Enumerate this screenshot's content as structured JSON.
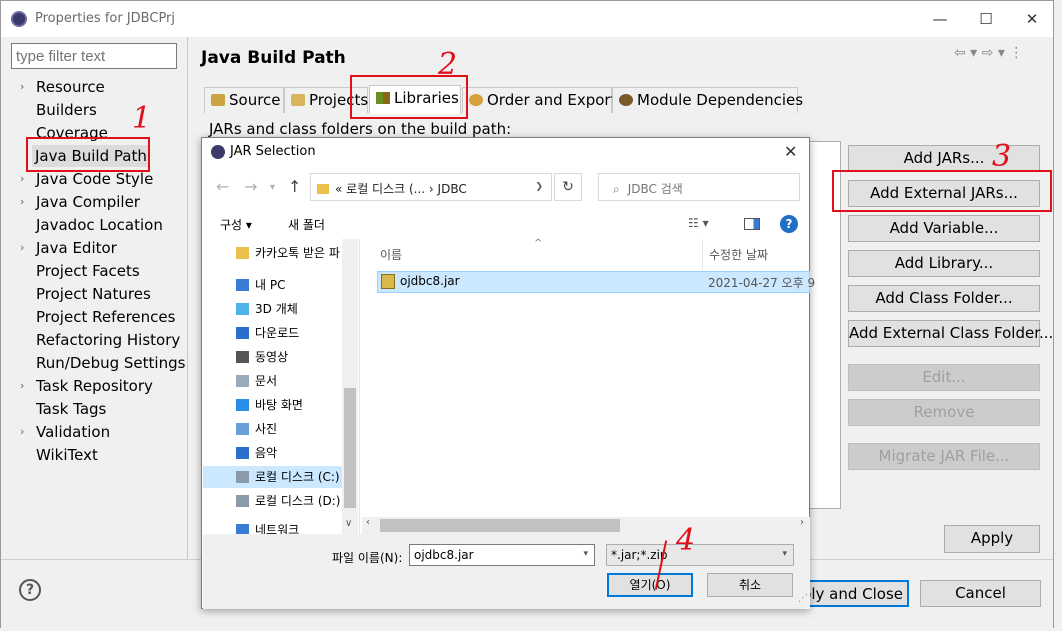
{
  "window": {
    "title": "Properties for JDBCPrj",
    "minimize_label": "—",
    "maximize_label": "☐",
    "close_label": "✕"
  },
  "filter": {
    "placeholder": "type filter text"
  },
  "tree": {
    "items": [
      {
        "label": "Resource",
        "expandable": true
      },
      {
        "label": "Builders",
        "expandable": false
      },
      {
        "label": "Coverage",
        "expandable": false
      },
      {
        "label": "Java Build Path",
        "expandable": false,
        "selected": true
      },
      {
        "label": "Java Code Style",
        "expandable": true
      },
      {
        "label": "Java Compiler",
        "expandable": true
      },
      {
        "label": "Javadoc Location",
        "expandable": false
      },
      {
        "label": "Java Editor",
        "expandable": true
      },
      {
        "label": "Project Facets",
        "expandable": false
      },
      {
        "label": "Project Natures",
        "expandable": false
      },
      {
        "label": "Project References",
        "expandable": false
      },
      {
        "label": "Refactoring History",
        "expandable": false
      },
      {
        "label": "Run/Debug Settings",
        "expandable": false
      },
      {
        "label": "Task Repository",
        "expandable": true
      },
      {
        "label": "Task Tags",
        "expandable": false
      },
      {
        "label": "Validation",
        "expandable": true
      },
      {
        "label": "WikiText",
        "expandable": false
      }
    ]
  },
  "page": {
    "title": "Java Build Path",
    "tabs": [
      {
        "label": "Source"
      },
      {
        "label": "Projects"
      },
      {
        "label": "Libraries",
        "active": true
      },
      {
        "label": "Order and Export"
      },
      {
        "label": "Module Dependencies"
      }
    ],
    "libraries_description": "JARs and class folders on the build path:",
    "buttons": {
      "add_jars": "Add JARs...",
      "add_external_jars": "Add External JARs...",
      "add_variable": "Add Variable...",
      "add_library": "Add Library...",
      "add_class_folder": "Add Class Folder...",
      "add_external_class_folder": "Add External Class Folder...",
      "edit": "Edit...",
      "remove": "Remove",
      "migrate_jar": "Migrate JAR File..."
    },
    "apply": "Apply",
    "apply_and_close": "Apply and Close",
    "cancel": "Cancel",
    "help": "?"
  },
  "annotations": {
    "mark1": "1",
    "mark2": "2",
    "mark3": "3",
    "mark4": "4"
  },
  "dialog": {
    "title": "JAR Selection",
    "close": "✕",
    "address": "«  로컬 디스크 (...  ›  JDBC",
    "search_placeholder": "JDBC 검색",
    "toolbar": {
      "organize": "구성 ▾",
      "new_folder": "새 폴더"
    },
    "nav_items": [
      {
        "label": "카카오톡 받은 파",
        "icon": "folder-icon"
      },
      {
        "label": "내 PC",
        "icon": "pc-icon"
      },
      {
        "label": "3D 개체",
        "icon": "cube-icon"
      },
      {
        "label": "다운로드",
        "icon": "download-icon"
      },
      {
        "label": "동영상",
        "icon": "video-icon"
      },
      {
        "label": "문서",
        "icon": "document-icon"
      },
      {
        "label": "바탕 화면",
        "icon": "desktop-icon"
      },
      {
        "label": "사진",
        "icon": "picture-icon"
      },
      {
        "label": "음악",
        "icon": "music-icon"
      },
      {
        "label": "로컬 디스크 (C:)",
        "icon": "drive-icon",
        "selected": true
      },
      {
        "label": "로컬 디스크 (D:)",
        "icon": "drive-icon"
      },
      {
        "label": "네트워크",
        "icon": "network-icon"
      }
    ],
    "columns": {
      "name": "이름",
      "modified": "수정한 날짜"
    },
    "files": [
      {
        "name": "ojdbc8.jar",
        "modified": "2021-04-27 오후 9"
      }
    ],
    "filename_label": "파일 이름(N):",
    "filename_value": "ojdbc8.jar",
    "filetype_value": "*.jar;*.zip",
    "open_button": "열기(O)",
    "cancel_button": "취소"
  },
  "colors": {
    "annotation_red": "#e0101a",
    "selection_blue": "#cce8ff",
    "default_button_blue": "#0078d7"
  }
}
